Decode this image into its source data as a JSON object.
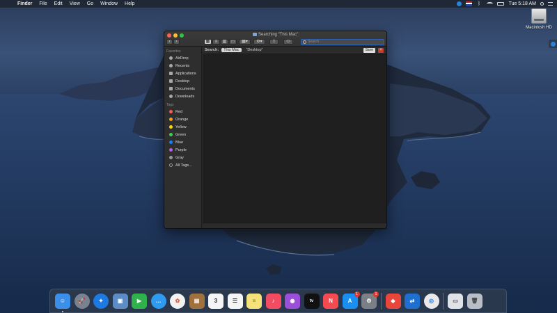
{
  "menubar": {
    "apple_glyph": "",
    "items": [
      "Finder",
      "File",
      "Edit",
      "View",
      "Go",
      "Window",
      "Help"
    ],
    "clock": "Tue 5:18 AM"
  },
  "desktop": {
    "hd_label": "Macintosh HD"
  },
  "finder": {
    "title": "Searching “This Mac”",
    "search_placeholder": "Search",
    "sidebar": {
      "favorites_header": "Favorites",
      "favorites": [
        "AirDrop",
        "Recents",
        "Applications",
        "Desktop",
        "Documents",
        "Downloads"
      ],
      "tags_header": "Tags",
      "tags": [
        {
          "label": "Red",
          "color": "#ff5a52"
        },
        {
          "label": "Orange",
          "color": "#ff9f0a"
        },
        {
          "label": "Yellow",
          "color": "#ffd60a"
        },
        {
          "label": "Green",
          "color": "#32d74b"
        },
        {
          "label": "Blue",
          "color": "#0a84ff"
        },
        {
          "label": "Purple",
          "color": "#bf5af2"
        },
        {
          "label": "Gray",
          "color": "#98989d"
        }
      ],
      "all_tags": "All Tags..."
    },
    "scopebar": {
      "label": "Search:",
      "scope_selected": "This Mac",
      "scope_other": "“Desktop”",
      "save_label": "Save",
      "plus_label": "+"
    }
  },
  "dock": {
    "items": [
      {
        "name": "Finder",
        "color": "#3c8fe8",
        "glyph": "☺",
        "running": true
      },
      {
        "name": "Launchpad",
        "color": "#7a8290",
        "glyph": "🚀"
      },
      {
        "name": "Safari",
        "color": "#1c7ae0",
        "glyph": "✦"
      },
      {
        "name": "Preview",
        "color": "#5d8cc4",
        "glyph": "▣"
      },
      {
        "name": "FaceTime",
        "color": "#2fb24c",
        "glyph": "▶"
      },
      {
        "name": "Messages",
        "color": "#2f9bf0",
        "glyph": "…"
      },
      {
        "name": "Photos",
        "color": "#f2f2f2",
        "glyph": "✿"
      },
      {
        "name": "Notefile",
        "color": "#a0713d",
        "glyph": "▤"
      },
      {
        "name": "Calendar",
        "color": "#f5f5f5",
        "glyph": "3"
      },
      {
        "name": "Reminders",
        "color": "#f5f5f5",
        "glyph": "☰"
      },
      {
        "name": "Notes",
        "color": "#f5e27a",
        "glyph": "≡"
      },
      {
        "name": "Music",
        "color": "#f34c62",
        "glyph": "♪"
      },
      {
        "name": "Podcasts",
        "color": "#9b4fd9",
        "glyph": "◉"
      },
      {
        "name": "TV",
        "color": "#111111",
        "glyph": "tv"
      },
      {
        "name": "News",
        "color": "#f34b50",
        "glyph": "N"
      },
      {
        "name": "App Store",
        "color": "#1b8ef2",
        "glyph": "A",
        "badge": "1"
      },
      {
        "name": "System Preferences",
        "color": "#7b7f86",
        "glyph": "⚙",
        "badge": "1"
      },
      {
        "name": "AnyDesk",
        "color": "#e8463a",
        "glyph": "◆"
      },
      {
        "name": "TeamViewer",
        "color": "#1e6fd0",
        "glyph": "⇄"
      },
      {
        "name": "Chrome",
        "color": "#e9e9e9",
        "glyph": "◎"
      },
      {
        "name": "Documents",
        "color": "#dfe2e6",
        "glyph": "▭"
      },
      {
        "name": "Trash",
        "color": "#b8bec6",
        "glyph": "🗑"
      }
    ]
  }
}
